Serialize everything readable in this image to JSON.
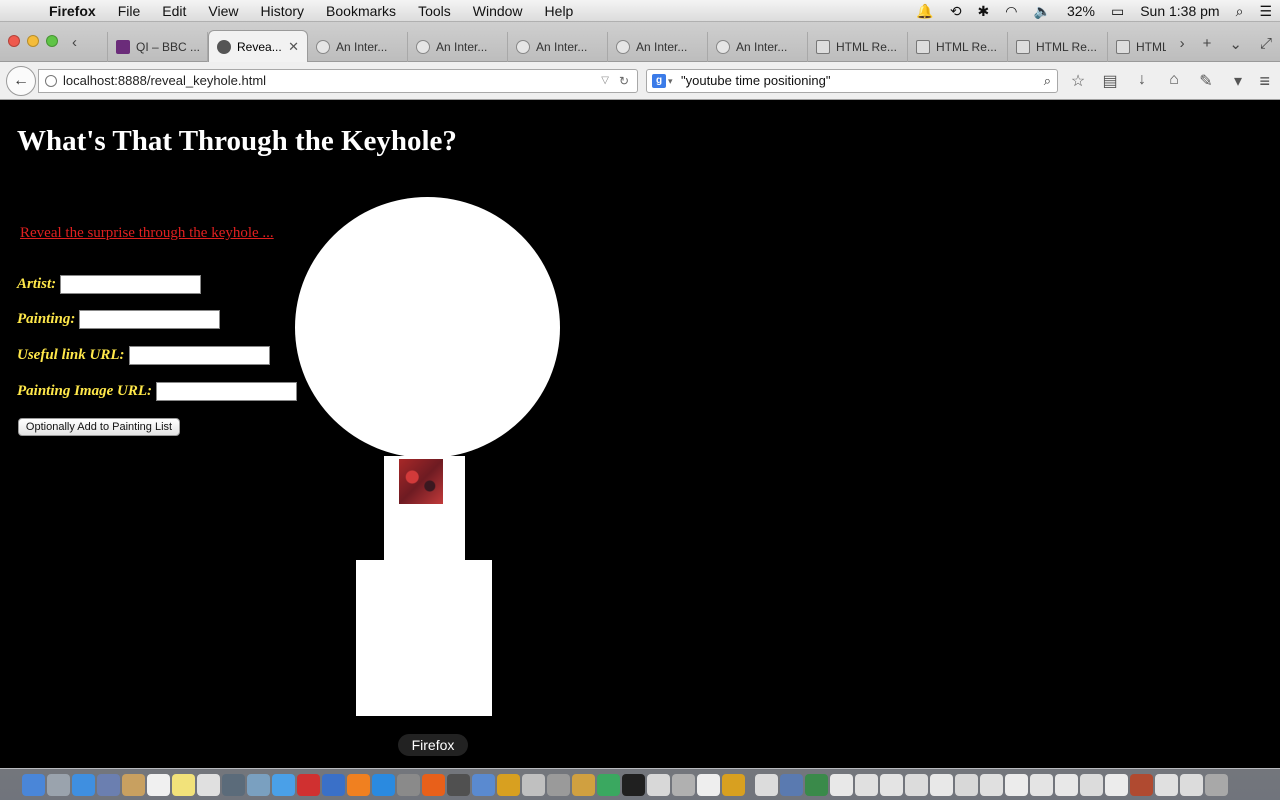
{
  "menubar": {
    "app": "Firefox",
    "items": [
      "File",
      "Edit",
      "View",
      "History",
      "Bookmarks",
      "Tools",
      "Window",
      "Help"
    ],
    "battery": "32%",
    "clock": "Sun 1:38 pm"
  },
  "tabs": [
    {
      "label": "QI – BBC ...",
      "icon": "bbc-icon"
    },
    {
      "label": "Revea...",
      "icon": "globe-icon",
      "active": true
    },
    {
      "label": "An Inter...",
      "icon": "clock-icon"
    },
    {
      "label": "An Inter...",
      "icon": "clock-icon"
    },
    {
      "label": "An Inter...",
      "icon": "clock-icon"
    },
    {
      "label": "An Inter...",
      "icon": "clock-icon"
    },
    {
      "label": "An Inter...",
      "icon": "clock-icon"
    },
    {
      "label": "HTML Re...",
      "icon": "code-icon"
    },
    {
      "label": "HTML Re...",
      "icon": "code-icon"
    },
    {
      "label": "HTML Re...",
      "icon": "code-icon"
    },
    {
      "label": "HTML",
      "icon": "code-icon"
    }
  ],
  "navbar": {
    "url": "localhost:8888/reveal_keyhole.html",
    "search": "\"youtube time positioning\""
  },
  "page": {
    "title": "What's That Through the Keyhole?",
    "reveal_link": "Reveal the surprise through the keyhole ...",
    "fields": {
      "artist": "Artist:",
      "painting": "Painting:",
      "link_url": "Useful link URL:",
      "image_url": "Painting Image URL:"
    },
    "add_button": "Optionally Add to Painting List",
    "colors": {
      "background": "#000000",
      "title": "#ffffff",
      "link": "#e02020",
      "labels": "#ffe84a",
      "keyhole": "#ffffff"
    }
  },
  "dock": {
    "tooltip": "Firefox"
  }
}
